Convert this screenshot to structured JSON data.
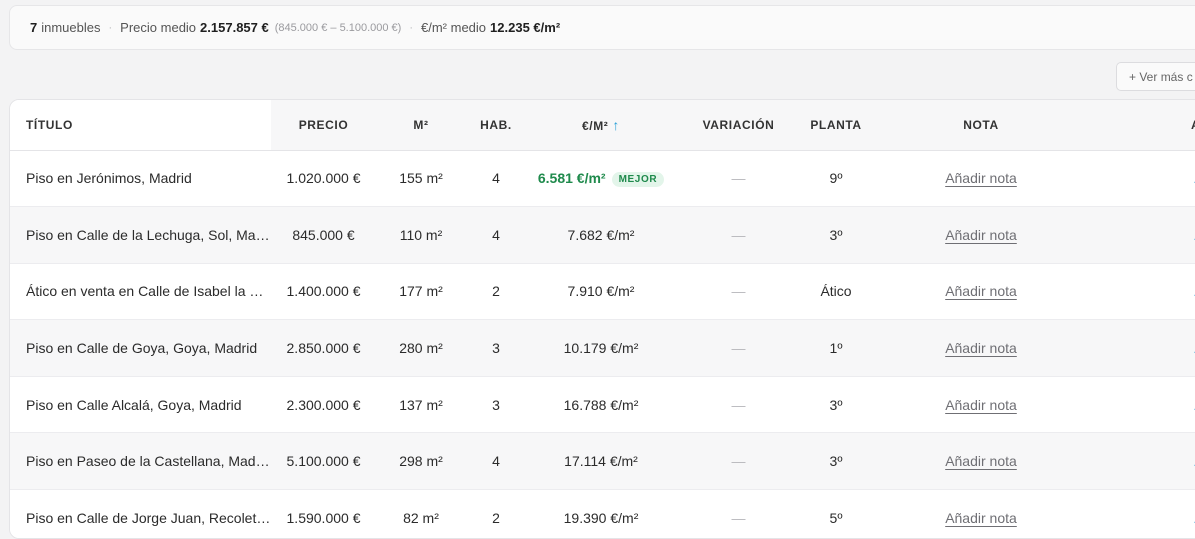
{
  "summary": {
    "count": "7",
    "count_label": "inmuebles",
    "price_label": "Precio medio",
    "price_value": "2.157.857 €",
    "price_range": "(845.000 € – 5.100.000 €)",
    "sqm_label": "€/m² medio",
    "sqm_value": "12.235 €/m²"
  },
  "more_button": "+ Ver más c",
  "table": {
    "headers": {
      "title": "Título",
      "price": "Precio",
      "m2": "M²",
      "rooms": "Hab.",
      "eur_m2": "€/M²",
      "sort_arrow": "↑",
      "variation": "Variación",
      "floor": "Planta",
      "note": "Nota",
      "actions": "Acciones"
    },
    "best_badge": "MEJOR",
    "rows": [
      {
        "title": "Piso en Jerónimos, Madrid",
        "price": "1.020.000 €",
        "m2": "155 m²",
        "rooms": "4",
        "eur_m2": "6.581 €/m²",
        "variation": "—",
        "floor": "9º",
        "note": "Añadir nota",
        "action": "Abrir anuncio"
      },
      {
        "title": "Piso en Calle de la Lechuga, Sol, Madrid",
        "price": "845.000 €",
        "m2": "110 m²",
        "rooms": "4",
        "eur_m2": "7.682 €/m²",
        "variation": "—",
        "floor": "3º",
        "note": "Añadir nota",
        "action": "Abrir anuncio"
      },
      {
        "title": "Ático en venta en Calle de Isabel la Católica",
        "price": "1.400.000 €",
        "m2": "177 m²",
        "rooms": "2",
        "eur_m2": "7.910 €/m²",
        "variation": "—",
        "floor": "Ático",
        "note": "Añadir nota",
        "action": "Abrir anuncio"
      },
      {
        "title": "Piso en Calle de Goya, Goya, Madrid",
        "price": "2.850.000 €",
        "m2": "280 m²",
        "rooms": "3",
        "eur_m2": "10.179 €/m²",
        "variation": "—",
        "floor": "1º",
        "note": "Añadir nota",
        "action": "Abrir anuncio"
      },
      {
        "title": "Piso en Calle Alcalá, Goya, Madrid",
        "price": "2.300.000 €",
        "m2": "137 m²",
        "rooms": "3",
        "eur_m2": "16.788 €/m²",
        "variation": "—",
        "floor": "3º",
        "note": "Añadir nota",
        "action": "Abrir anuncio"
      },
      {
        "title": "Piso en Paseo de la Castellana, Madrid",
        "price": "5.100.000 €",
        "m2": "298 m²",
        "rooms": "4",
        "eur_m2": "17.114 €/m²",
        "variation": "—",
        "floor": "3º",
        "note": "Añadir nota",
        "action": "Abrir anuncio"
      },
      {
        "title": "Piso en Calle de Jorge Juan, Recoletos, Madrid",
        "price": "1.590.000 €",
        "m2": "82 m²",
        "rooms": "2",
        "eur_m2": "19.390 €/m²",
        "variation": "—",
        "floor": "5º",
        "note": "Añadir nota",
        "action": "Abrir anuncio"
      }
    ]
  }
}
